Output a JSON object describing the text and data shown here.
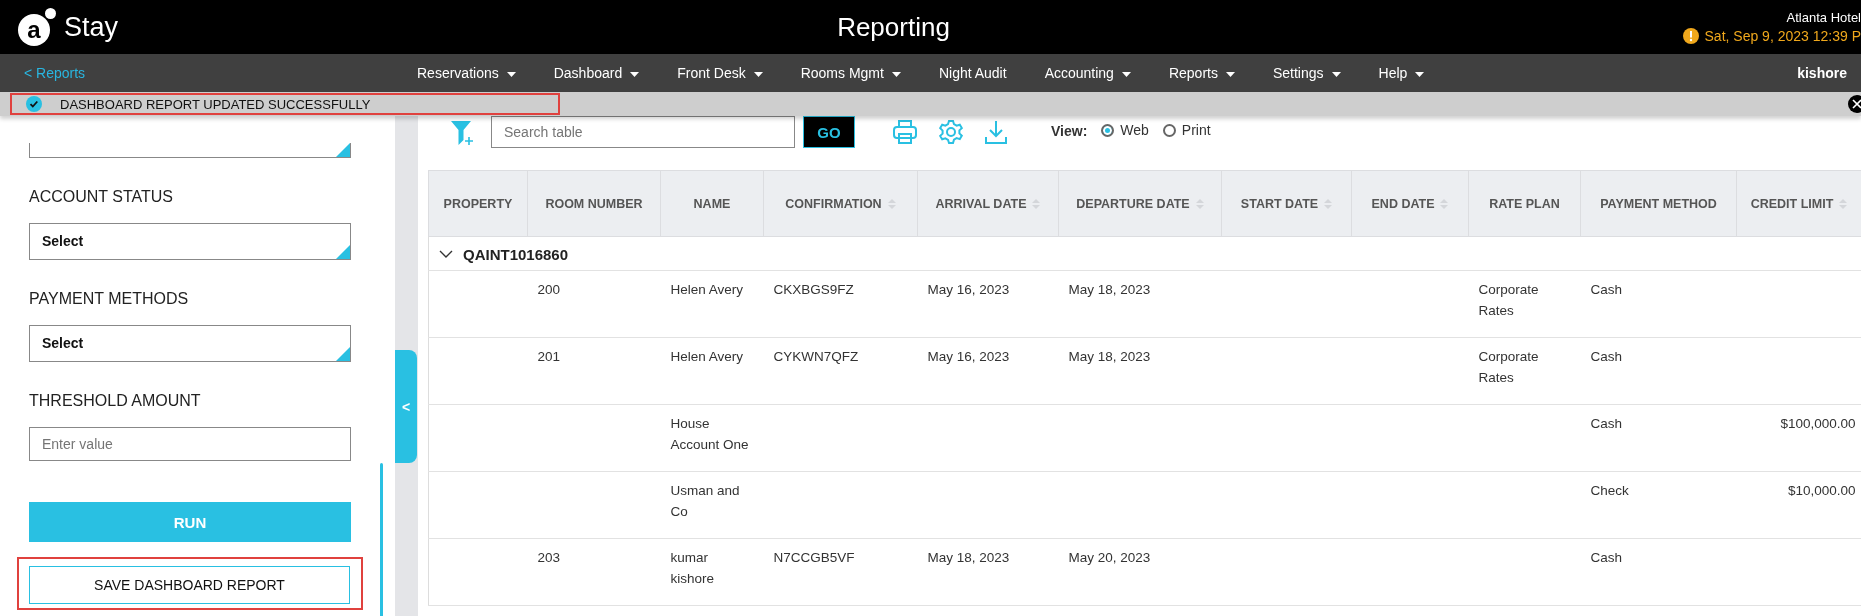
{
  "header": {
    "logo": {
      "mark": "a",
      "text": "Stay"
    },
    "title": "Reporting",
    "hotel": "Atlanta Hotel",
    "datetime": "Sat, Sep 9, 2023 12:39 P"
  },
  "nav": {
    "back": "< Reports",
    "items": [
      {
        "label": "Reservations",
        "dropdown": true
      },
      {
        "label": "Dashboard",
        "dropdown": true
      },
      {
        "label": "Front Desk",
        "dropdown": true
      },
      {
        "label": "Rooms Mgmt",
        "dropdown": true
      },
      {
        "label": "Night Audit",
        "dropdown": false
      },
      {
        "label": "Accounting",
        "dropdown": true
      },
      {
        "label": "Reports",
        "dropdown": true
      },
      {
        "label": "Settings",
        "dropdown": true
      },
      {
        "label": "Help",
        "dropdown": true
      }
    ],
    "user": "kishore"
  },
  "notification": {
    "text": "DASHBOARD REPORT UPDATED SUCCESSFULLY",
    "highlighted": true
  },
  "filters": [
    {
      "kind": "select"
    },
    {
      "kind": "select",
      "label": "ACCOUNT STATUS",
      "value": "Select"
    },
    {
      "kind": "select",
      "label": "PAYMENT METHODS",
      "value": "Select"
    },
    {
      "kind": "input",
      "label": "THRESHOLD AMOUNT",
      "placeholder": "Enter value"
    }
  ],
  "run_button": "RUN",
  "save_button": {
    "label": "SAVE DASHBOARD REPORT",
    "highlighted": true
  },
  "collapse_toggle": "<",
  "toolbar": {
    "search": {
      "placeholder": "Search table"
    },
    "go_button": "GO",
    "view": {
      "label": "View:",
      "options": [
        {
          "label": "Web",
          "selected": true
        },
        {
          "label": "Print",
          "selected": false
        }
      ]
    }
  },
  "table": {
    "columns": [
      {
        "label": "PROPERTY",
        "sortable": false
      },
      {
        "label": "ROOM NUMBER",
        "sortable": false
      },
      {
        "label": "NAME",
        "sortable": false
      },
      {
        "label": "CONFIRMATION",
        "sortable": true
      },
      {
        "label": "ARRIVAL DATE",
        "sortable": true
      },
      {
        "label": "DEPARTURE DATE",
        "sortable": true
      },
      {
        "label": "START DATE",
        "sortable": true
      },
      {
        "label": "END DATE",
        "sortable": true
      },
      {
        "label": "RATE PLAN",
        "sortable": false
      },
      {
        "label": "PAYMENT METHOD",
        "sortable": false
      },
      {
        "label": "CREDIT LIMIT",
        "sortable": true
      }
    ],
    "group": {
      "label": "QAINT1016860",
      "expanded": true
    },
    "rows": [
      [
        null,
        "200",
        "Helen Avery",
        "CKXBGS9FZ",
        "May 16, 2023",
        "May 18, 2023",
        null,
        null,
        "Corporate Rates",
        "Cash",
        null
      ],
      [
        null,
        "201",
        "Helen Avery",
        "CYKWN7QFZ",
        "May 16, 2023",
        "May 18, 2023",
        null,
        null,
        "Corporate Rates",
        "Cash",
        null
      ],
      [
        null,
        null,
        "House Account One",
        null,
        null,
        null,
        null,
        null,
        null,
        "Cash",
        "$100,000.00"
      ],
      [
        null,
        null,
        "Usman and Co",
        null,
        null,
        null,
        null,
        null,
        null,
        "Check",
        "$10,000.00"
      ],
      [
        null,
        "203",
        "kumar kishore",
        "N7CCGB5VF",
        "May 18, 2023",
        "May 20, 2023",
        null,
        null,
        null,
        "Cash",
        null
      ]
    ]
  }
}
